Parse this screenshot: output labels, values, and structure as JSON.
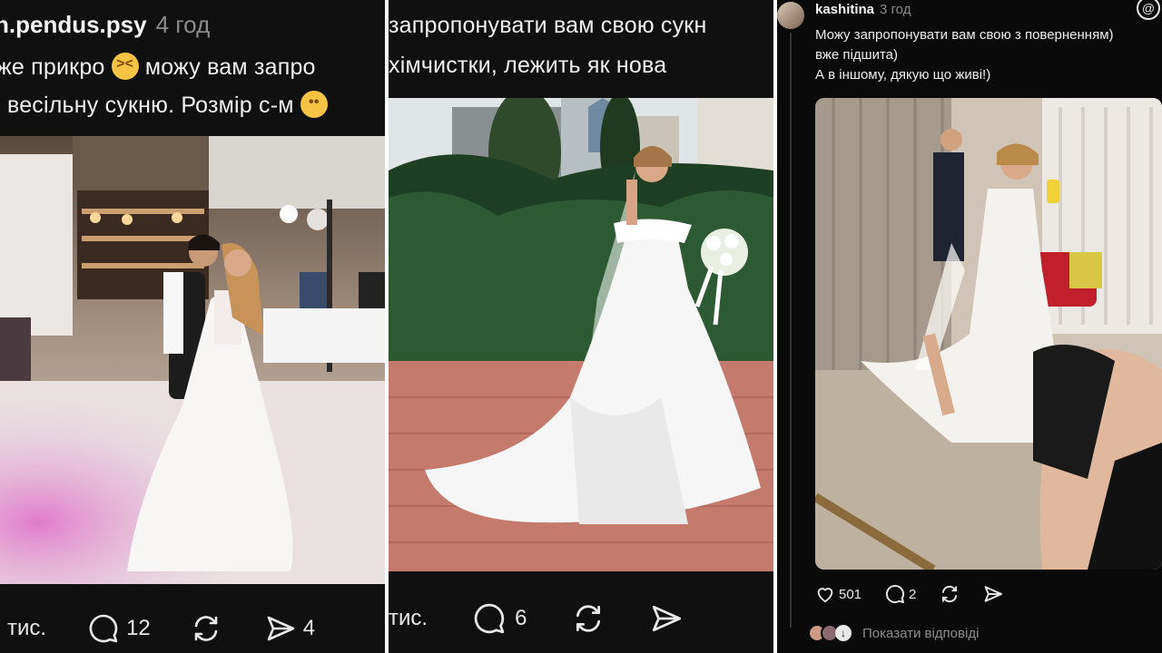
{
  "panel1": {
    "username": "n.pendus.psy",
    "time": "4 год",
    "line1_a": "же прикро",
    "line1_b": "можу вам запро",
    "line2_a": "весільну сукню. Розмір с-м",
    "emoji_sad": "pleading-face",
    "emoji_angry": "persevering-face",
    "photo": "bride and groom dancing in wedding hall with stage smoke",
    "likes": "тис.",
    "comments": "12",
    "shares": "4"
  },
  "panel2": {
    "line1": "запропонувати вам свою сукн",
    "line2": "хімчистки, лежить як нова",
    "photo": "bride in off-shoulder satin gown with bouquet outdoors",
    "likes": "тис.",
    "comments": "6"
  },
  "panel3": {
    "username": "kashitina",
    "time": "3 год",
    "text_line1": "Можу запропонувати вам свою з поверненням)",
    "text_line2": "вже підшита)",
    "text_line3": "А в іншому, дякую що живі!)",
    "photo": "mirror selfie in wedding dress with slit in bridal salon",
    "likes": "501",
    "comments": "2",
    "show_replies": "Показати відповіді"
  },
  "colors": {
    "panel_bg": "#101010",
    "muted": "#8c8c8c",
    "text": "#f0f0f0"
  }
}
